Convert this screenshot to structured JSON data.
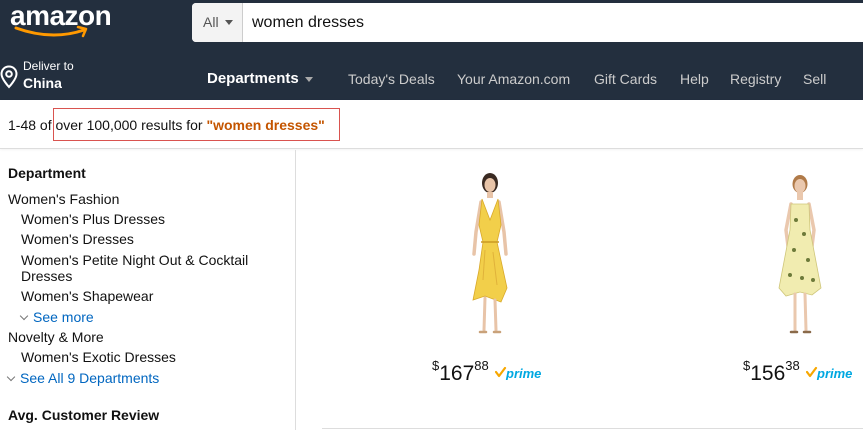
{
  "header": {
    "logo_text": "amazon",
    "search": {
      "department": "All",
      "query": "women dresses"
    }
  },
  "nav": {
    "deliver_label": "Deliver to",
    "deliver_location": "China",
    "departments_label": "Departments",
    "links": [
      "Today's Deals",
      "Your Amazon.com",
      "Gift Cards",
      "Help",
      "Registry",
      "Sell"
    ]
  },
  "results": {
    "range_text": "1-48 of over 100,000 results for ",
    "query": "\"women dresses\""
  },
  "sidebar": {
    "department_heading": "Department",
    "items": [
      {
        "label": "Women's Fashion"
      },
      {
        "label": "Women's Plus Dresses"
      },
      {
        "label": "Women's Dresses"
      },
      {
        "label": "Women's Petite Night Out & Cocktail"
      },
      {
        "label": "Dresses"
      },
      {
        "label": "Women's Shapewear"
      },
      {
        "label": "See more"
      },
      {
        "label": "Novelty & More"
      },
      {
        "label": "Women's Exotic Dresses"
      },
      {
        "label": "See All 9 Departments"
      }
    ],
    "review_heading": "Avg. Customer Review"
  },
  "products": [
    {
      "price_symbol": "$",
      "price_whole": "167",
      "price_fraction": "88",
      "badge": "prime"
    },
    {
      "price_symbol": "$",
      "price_whole": "156",
      "price_fraction": "38",
      "badge": "prime"
    }
  ],
  "colors": {
    "header_bg": "#232f3e",
    "link": "#0066c0",
    "query": "#c45500",
    "prime_blue": "#00a8e1",
    "prime_check": "#f7a700",
    "dress1": "#f2cf4a",
    "dress2": "#f1ecb0"
  }
}
